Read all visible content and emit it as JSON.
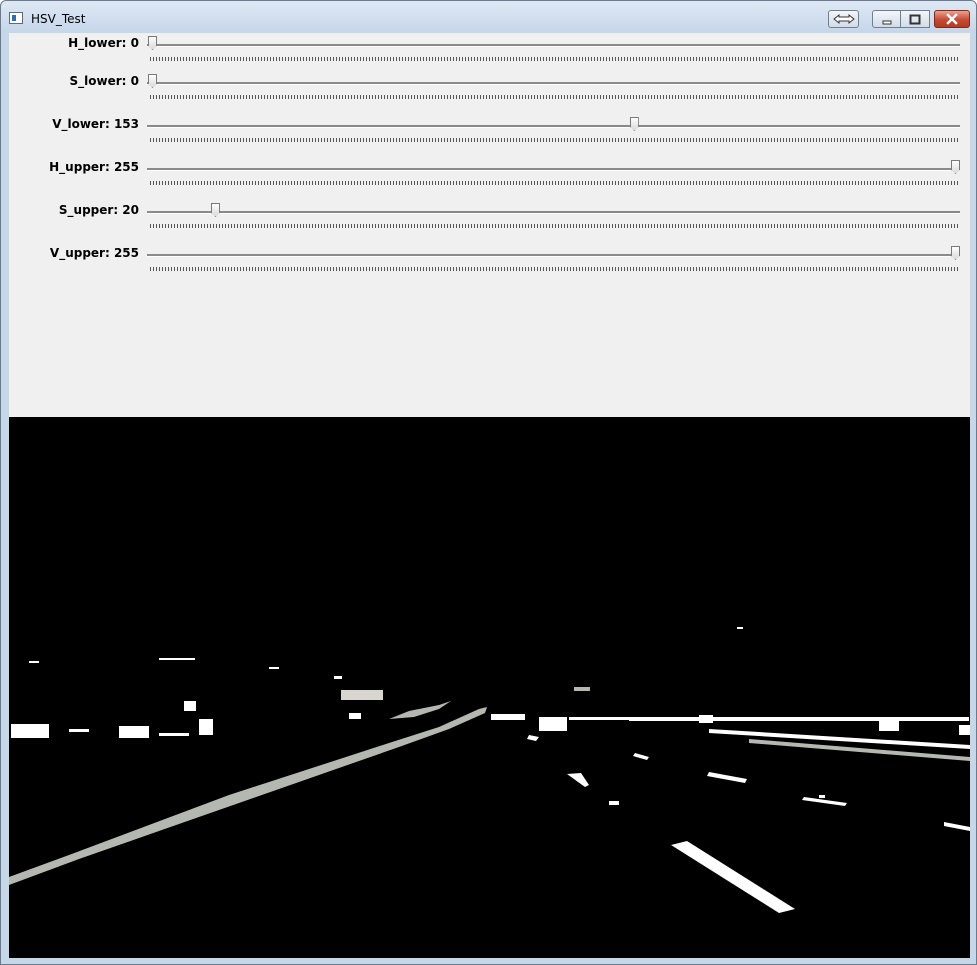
{
  "window": {
    "title": "HSV_Test"
  },
  "titlebar_buttons": {
    "restore_arrows_icon": "double-arrow-icon",
    "minimize_icon": "minimize-icon",
    "maximize_icon": "maximize-icon",
    "close_icon": "close-icon"
  },
  "sliders": [
    {
      "label": "H_lower: 0",
      "value": 0,
      "max": 255
    },
    {
      "label": "S_lower: 0",
      "value": 0,
      "max": 255
    },
    {
      "label": "V_lower: 153",
      "value": 153,
      "max": 255
    },
    {
      "label": "H_upper: 255",
      "value": 255,
      "max": 255
    },
    {
      "label": "S_upper: 20",
      "value": 20,
      "max": 255
    },
    {
      "label": "V_upper: 255",
      "value": 255,
      "max": 255
    }
  ],
  "image": {
    "description_colors": {
      "background": "#000000",
      "bright": "#ffffff",
      "dim": "#b5b8b0"
    }
  }
}
